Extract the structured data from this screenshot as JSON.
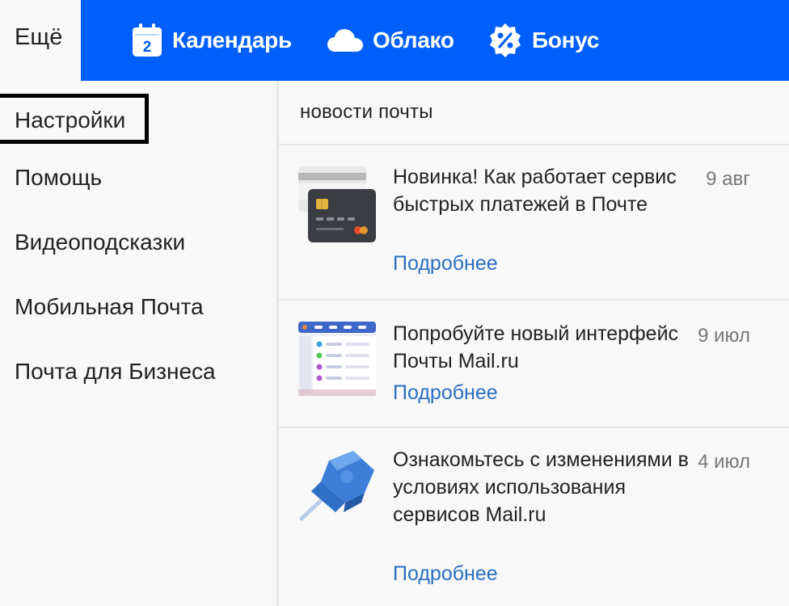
{
  "topbar": {
    "more_label": "Ещё",
    "items": [
      {
        "label": "Календарь",
        "icon": "calendar-icon",
        "badge": "2"
      },
      {
        "label": "Облако",
        "icon": "cloud-icon"
      },
      {
        "label": "Бонус",
        "icon": "bonus-percent-icon"
      }
    ]
  },
  "menu": {
    "items": [
      {
        "label": "Настройки",
        "active": true
      },
      {
        "label": "Помощь"
      },
      {
        "label": "Видеоподсказки"
      },
      {
        "label": "Мобильная Почта"
      },
      {
        "label": "Почта для Бизнеса"
      }
    ]
  },
  "news": {
    "title": "новости почты",
    "items": [
      {
        "text": "Новинка! Как работает сервис быстрых платежей в Почте",
        "date": "9 авг",
        "link": "Подробнее",
        "icon": "bank-cards-icon"
      },
      {
        "text": "Попробуйте новый интерфейс Почты Mail.ru",
        "date": "9 июл",
        "link": "Подробнее",
        "icon": "mail-interface-icon"
      },
      {
        "text": "Ознакомьтесь с изменениями в условиях использования сервисов Mail.ru",
        "date": "4 июл",
        "link": "Подробнее",
        "icon": "pushpin-icon"
      }
    ]
  },
  "colors": {
    "brand_blue": "#005ff9",
    "link": "#2a6fc1",
    "date": "#777777"
  }
}
